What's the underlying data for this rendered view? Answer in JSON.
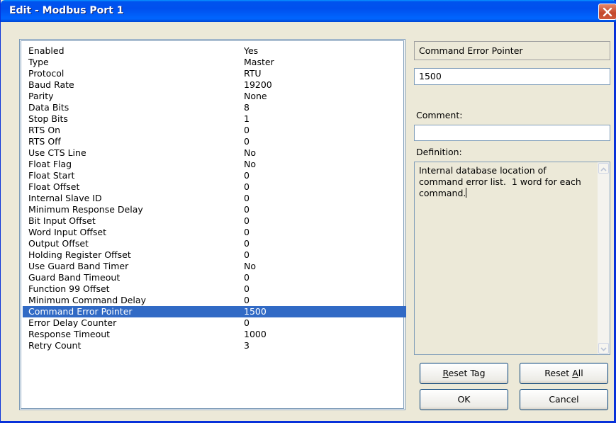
{
  "window": {
    "title": "Edit - Modbus Port 1"
  },
  "properties": [
    {
      "name": "Enabled",
      "value": "Yes"
    },
    {
      "name": "Type",
      "value": "Master"
    },
    {
      "name": "Protocol",
      "value": "RTU"
    },
    {
      "name": "Baud Rate",
      "value": "19200"
    },
    {
      "name": "Parity",
      "value": "None"
    },
    {
      "name": "Data Bits",
      "value": "8"
    },
    {
      "name": "Stop Bits",
      "value": "1"
    },
    {
      "name": "RTS On",
      "value": "0"
    },
    {
      "name": "RTS Off",
      "value": "0"
    },
    {
      "name": "Use CTS Line",
      "value": "No"
    },
    {
      "name": "Float Flag",
      "value": "No"
    },
    {
      "name": "Float Start",
      "value": "0"
    },
    {
      "name": "Float Offset",
      "value": "0"
    },
    {
      "name": "Internal Slave ID",
      "value": "0"
    },
    {
      "name": "Minimum Response Delay",
      "value": "0"
    },
    {
      "name": "Bit Input Offset",
      "value": "0"
    },
    {
      "name": "Word Input Offset",
      "value": "0"
    },
    {
      "name": "Output Offset",
      "value": "0"
    },
    {
      "name": "Holding Register Offset",
      "value": "0"
    },
    {
      "name": "Use Guard Band Timer",
      "value": "No"
    },
    {
      "name": "Guard Band Timeout",
      "value": "0"
    },
    {
      "name": "Function 99 Offset",
      "value": "0"
    },
    {
      "name": "Minimum Command Delay",
      "value": "0"
    },
    {
      "name": "Command Error Pointer",
      "value": "1500"
    },
    {
      "name": "Error Delay Counter",
      "value": "0"
    },
    {
      "name": "Response Timeout",
      "value": "1000"
    },
    {
      "name": "Retry Count",
      "value": "3"
    }
  ],
  "selected_index": 23,
  "editor": {
    "field_name": "Command Error Pointer",
    "value": "1500",
    "comment_label": "Comment:",
    "comment_value": "",
    "definition_label": "Definition:",
    "definition_text": "Internal database location of command error list.  1 word for each command."
  },
  "buttons": {
    "reset_tag": {
      "accel": "R",
      "rest": "eset Tag"
    },
    "reset_all": {
      "pre": "Reset ",
      "accel": "A",
      "rest": "ll"
    },
    "ok": "OK",
    "cancel": "Cancel"
  },
  "colors": {
    "selection": "#316ac5",
    "titlebar": "#0053ee",
    "dialog_bg": "#ece9d8"
  }
}
